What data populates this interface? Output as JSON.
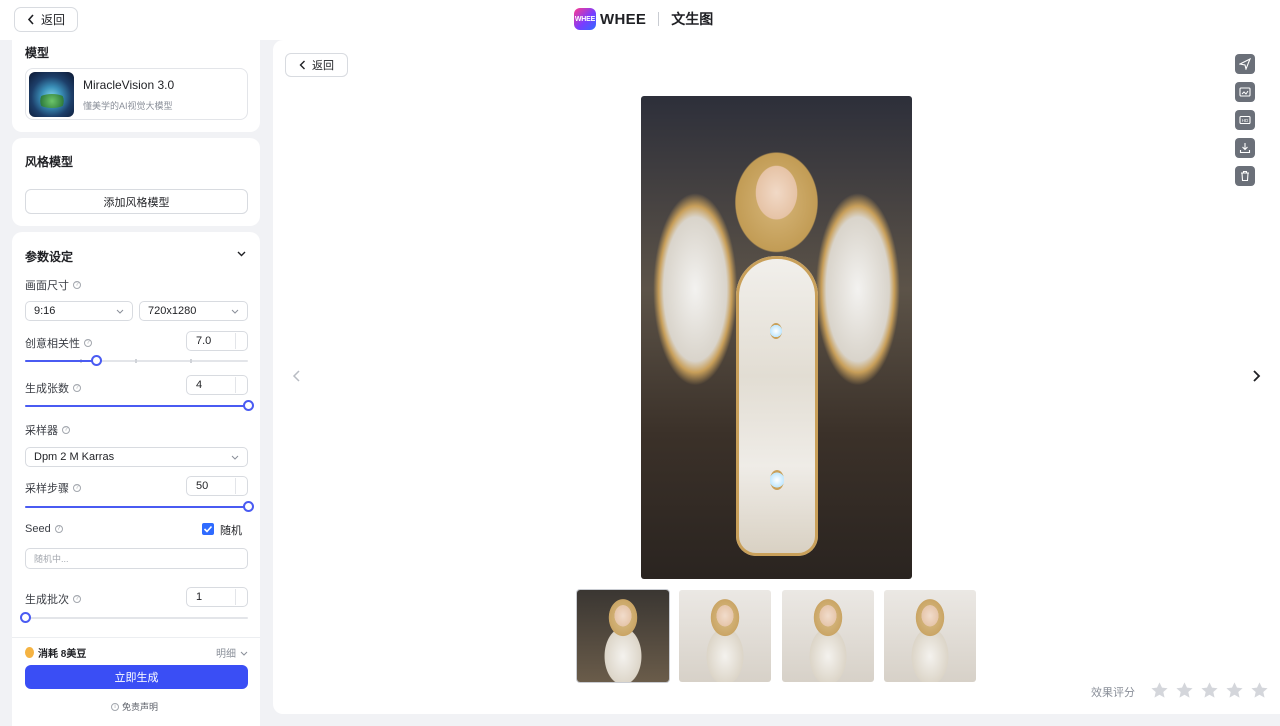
{
  "topbar": {
    "back_label": "返回",
    "logo_badge": "WHEE",
    "logo_text": "WHEE",
    "app_title": "文生图"
  },
  "sidebar": {
    "model_section": {
      "title": "模型",
      "model_name": "MiracleVision 3.0",
      "model_desc": "懂美学的AI视觉大模型"
    },
    "style_section": {
      "title": "风格模型",
      "add_button": "添加风格模型"
    },
    "params": {
      "title": "参数设定",
      "size": {
        "label": "画面尺寸",
        "ratio": "9:16",
        "resolution": "720x1280"
      },
      "creativity": {
        "label": "创意相关性",
        "value": "7.0",
        "slider_fraction": 0.32
      },
      "count": {
        "label": "生成张数",
        "value": "4",
        "slider_fraction": 1.0
      },
      "sampler": {
        "label": "采样器",
        "value": "Dpm 2 M Karras"
      },
      "steps": {
        "label": "采样步骤",
        "value": "50",
        "slider_fraction": 1.0
      },
      "seed": {
        "label": "Seed",
        "random_label": "随机",
        "random_checked": true,
        "placeholder": "随机中..."
      },
      "batch": {
        "label": "生成批次",
        "value": "1",
        "slider_fraction": 0.0
      }
    },
    "footer": {
      "cost_label": "消耗 8美豆",
      "detail_label": "明细",
      "generate_button": "立即生成",
      "disclaimer": "免责声明"
    }
  },
  "main": {
    "back_label": "返回",
    "toolbar_icons": [
      "send-icon",
      "image-edit-icon",
      "hd-icon",
      "download-icon",
      "trash-icon"
    ],
    "thumbnails_count": 4,
    "rating": {
      "label": "效果评分",
      "stars": 5,
      "selected": 0
    }
  },
  "colors": {
    "accent": "#3a4ef5",
    "slider": "#4a5bf2",
    "checkbox": "#2f6bff",
    "tool_bg": "#6b7079"
  }
}
